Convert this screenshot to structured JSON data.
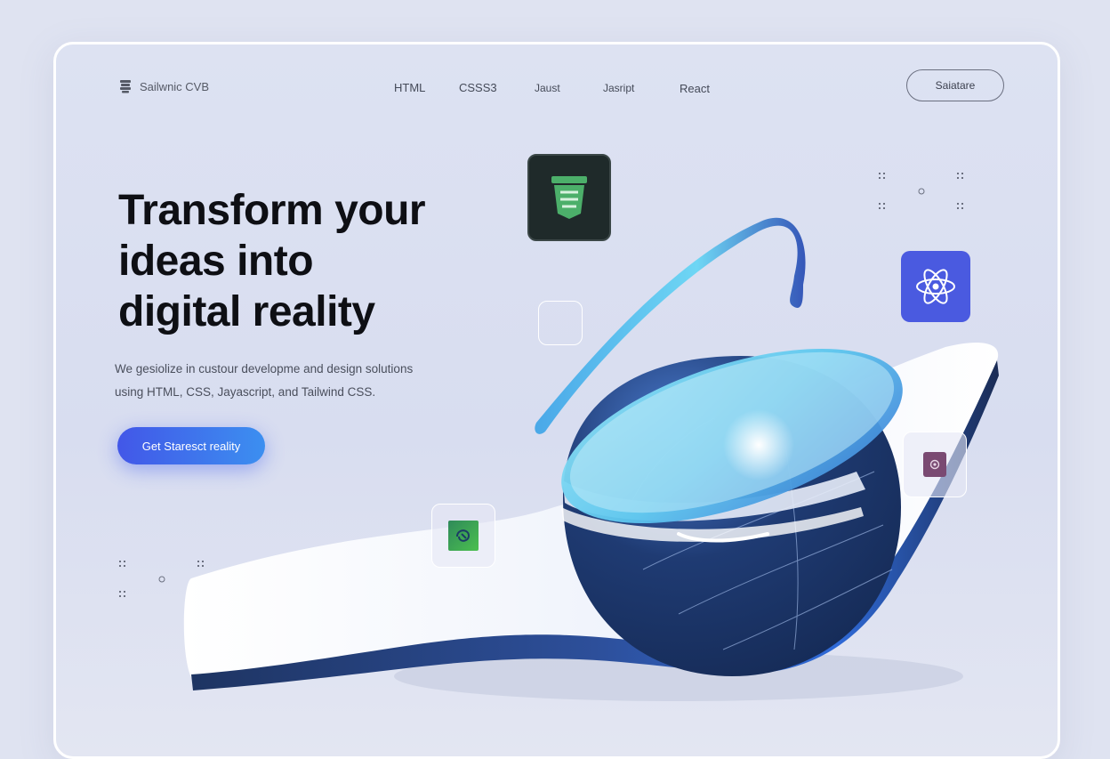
{
  "header": {
    "logo_text": "Sailwnic CVB",
    "nav": [
      "HTML",
      "CSSS3",
      "Jaust",
      "Jasript",
      "React"
    ],
    "cta_label": "Saiatare"
  },
  "hero": {
    "headline_lines": [
      "Transform your",
      "ideas into",
      "digital reality"
    ],
    "subtext_lines": [
      "We gesiolize in custour developme and design solutions",
      "using HTML, CSS, Jayascript, and Tailwind CSS."
    ],
    "button_label": "Get Staresct reality"
  },
  "icons": {
    "html": "html5-icon",
    "react": "react-atom-icon",
    "settings": "gear-icon",
    "tailwind": "leaf-icon"
  },
  "colors": {
    "background": "#dfe3f1",
    "accent_start": "#4257e8",
    "accent_end": "#3c8ff0",
    "react_badge": "#4a5ae0",
    "html_badge": "#1f2a2a",
    "html_shield": "#4caf6a",
    "sphere_dark": "#1c3566",
    "sphere_light": "#6fd0f0"
  }
}
